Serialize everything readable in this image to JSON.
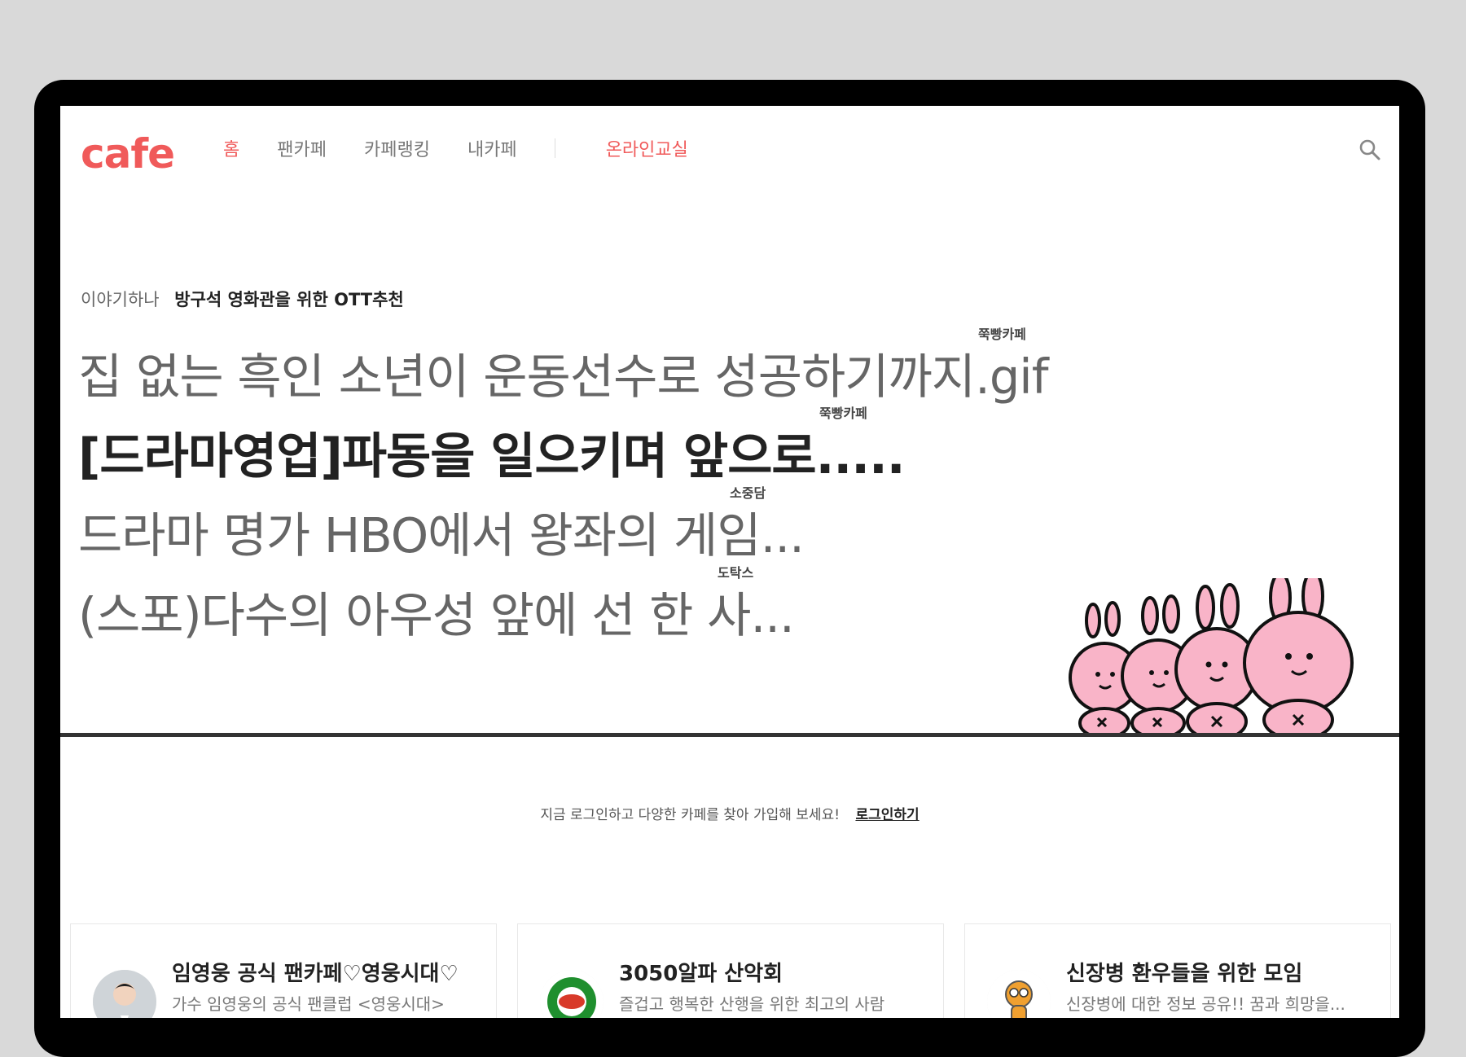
{
  "header": {
    "logo": "cafe",
    "nav": [
      {
        "label": "홈",
        "active": true
      },
      {
        "label": "팬카페"
      },
      {
        "label": "카페랭킹"
      },
      {
        "label": "내카페"
      }
    ],
    "nav_accent": "온라인교실"
  },
  "hero": {
    "category": "이야기하나",
    "topic": "방구석 영화관을 위한 OTT추천",
    "headlines": [
      {
        "title": "집 없는 흑인 소년이 운동선수로 성공하기까지.gif",
        "source": "쭉빵카페"
      },
      {
        "title": "[드라마영업]파동을 일으키며 앞으로.....",
        "source": "쭉빵카페"
      },
      {
        "title": "드라마 명가 HBO에서 왕좌의 게임...",
        "source": "소중담"
      },
      {
        "title": "(스포)다수의 아우성 앞에 선 한 사...",
        "source": "도탁스"
      }
    ]
  },
  "login_notice": {
    "text": "지금 로그인하고 다양한 카페를 찾아 가입해 보세요!",
    "link": "로그인하기"
  },
  "cafes": [
    {
      "name": "임영웅 공식 팬카페♡영웅시대♡",
      "desc": "가수 임영웅의 공식 팬클럽 <영웅시대>"
    },
    {
      "name": "3050알파 산악회",
      "desc": "즐겁고 행복한 산행을 위한 최고의 사람"
    },
    {
      "name": "신장병 환우들을 위한 모임",
      "desc": "신장병에 대한 정보 공유!! 꿈과 희망을..."
    }
  ],
  "colors": {
    "brand": "#f05a5a",
    "rabbit": "#f9b4c8"
  }
}
